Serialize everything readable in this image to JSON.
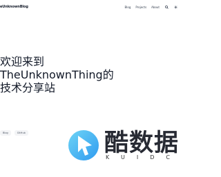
{
  "nav": {
    "brand": "eUnknownBlog",
    "links": [
      "Blog",
      "Projects",
      "About"
    ],
    "icons": [
      "search-icon",
      "theme-toggle-icon"
    ]
  },
  "hero": {
    "line1": "欢迎来到",
    "line2": "TheUnknownThing的",
    "line3": "技术分享站"
  },
  "tags": [
    "Blog",
    "GitHub"
  ],
  "watermark": {
    "title": "酷数据",
    "subtitle": "KUIDC"
  },
  "colors": {
    "logo_blue": "#2f9bf0",
    "logo_cyan": "#6ed4f5",
    "text": "#111827"
  }
}
